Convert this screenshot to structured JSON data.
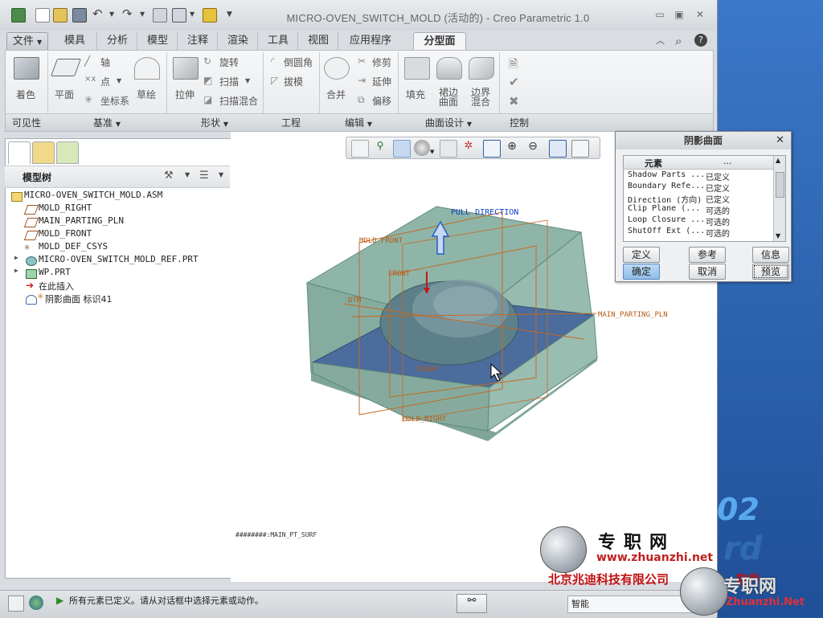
{
  "window": {
    "title": "MICRO-OVEN_SWITCH_MOLD (活动的) - Creo Parametric 1.0"
  },
  "menu_tabs": [
    "文件",
    "模具",
    "分析",
    "模型",
    "注释",
    "渲染",
    "工具",
    "视图",
    "应用程序",
    "分型面"
  ],
  "ribbon": {
    "visibility": {
      "label": "可见性",
      "shade": "着色"
    },
    "datum": {
      "label": "基准",
      "plane": "平面",
      "axis": "轴",
      "point": "点",
      "csys": "坐标系",
      "sketch": "草绘"
    },
    "shapes": {
      "label": "形状",
      "extrude": "拉伸",
      "revolve": "旋转",
      "sweep": "扫描",
      "swept_blend": "扫描混合"
    },
    "engineering": {
      "label": "工程",
      "round": "倒圆角",
      "draft": "拔模"
    },
    "editing": {
      "label": "编辑",
      "merge": "合并",
      "trim": "修剪",
      "extend": "延伸",
      "offset": "偏移"
    },
    "surface_design": {
      "label": "曲面设计",
      "fill": "填充",
      "skirt": "裙边\n曲面",
      "boundary": "边界\n混合"
    },
    "control": {
      "label": "控制"
    }
  },
  "model_tree": {
    "title": "模型树",
    "items": [
      {
        "label": "MICRO-OVEN_SWITCH_MOLD.ASM",
        "icon": "assembly-icon"
      },
      {
        "label": "MOLD_RIGHT",
        "icon": "datum-plane-icon"
      },
      {
        "label": "MAIN_PARTING_PLN",
        "icon": "datum-plane-icon"
      },
      {
        "label": "MOLD_FRONT",
        "icon": "datum-plane-icon"
      },
      {
        "label": "MOLD_DEF_CSYS",
        "icon": "csys-icon"
      },
      {
        "label": "MICRO-OVEN_SWITCH_MOLD_REF.PRT",
        "icon": "part-icon"
      },
      {
        "label": "WP.PRT",
        "icon": "part-icon"
      },
      {
        "label": "在此插入",
        "icon": "insert-here-icon"
      },
      {
        "label": "阴影曲面 标识41",
        "icon": "shadow-surface-icon"
      }
    ]
  },
  "graphics": {
    "labels": {
      "pull_direction": "PULL DIRECTION",
      "mold_front": "MOLD_FRONT",
      "front": "FRONT",
      "dtm": "DTM",
      "main_parting_pln": "MAIN_PARTING_PLN",
      "right": "RIGHT",
      "mold_right": "MOLD_RIGHT",
      "surf_name": "########:MAIN_PT_SURF"
    }
  },
  "dialog": {
    "title": "阴影曲面",
    "columns": [
      "元素",
      "..."
    ],
    "rows": [
      {
        "name": "Shadow Parts ...",
        "status": "已定义"
      },
      {
        "name": "Boundary Refe...",
        "status": "已定义"
      },
      {
        "name": "Direction (方向)",
        "status": "已定义"
      },
      {
        "name": "Clip Plane (...",
        "status": "可选的"
      },
      {
        "name": "Loop Closure ...",
        "status": "可选的"
      },
      {
        "name": "ShutOff Ext (...",
        "status": "可选的"
      }
    ],
    "buttons": {
      "define": "定义",
      "refs": "参考",
      "info": "信息",
      "ok": "确定",
      "cancel": "取消",
      "preview": "预览"
    }
  },
  "status": {
    "message": "所有元素已定义。请从对话框中选择元素或动作。",
    "filter": "智能"
  },
  "watermark": {
    "site_cn": "专职网",
    "site_url": "www.zhuanzhi.net",
    "company": "北京兆迪科技有限公司",
    "suffix": "软件",
    "site_cn2": "专职网",
    "site_url2": "Zhuanzhi.Net",
    "desk_num": "02",
    "desk_rd": "rd"
  }
}
